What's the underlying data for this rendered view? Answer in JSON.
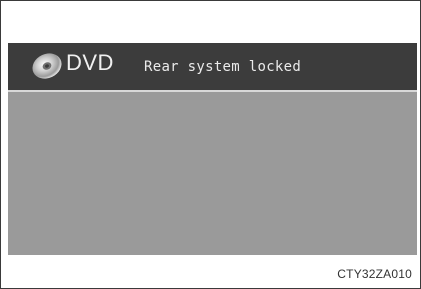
{
  "header": {
    "icon": "disc-icon",
    "source_label": "DVD",
    "status_message": "Rear system locked"
  },
  "figure": {
    "code": "CTY32ZA010"
  },
  "colors": {
    "header_background": "#3c3c3c",
    "screen_background": "#9a9a9a",
    "header_separator": "#d8d8d8",
    "text": "#f0f0f0"
  }
}
